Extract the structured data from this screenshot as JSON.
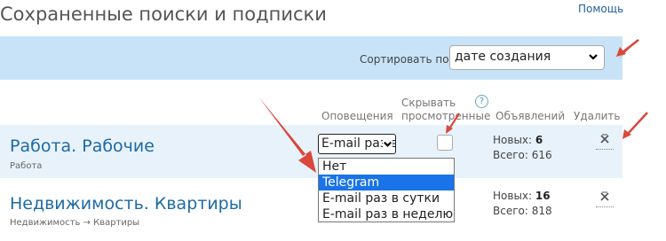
{
  "page": {
    "title": "Сохраненные поиски и подписки",
    "help_link": "Помощь"
  },
  "sort": {
    "label": "Сортировать по",
    "selected": "дате создания"
  },
  "columns": {
    "notifications": "Оповещения",
    "hide_viewed_line1": "Скрывать",
    "hide_viewed_line2": "просмотренные",
    "hide_viewed_help": "?",
    "listings": "Объявлений",
    "delete": "Удалить"
  },
  "rows": [
    {
      "title": "Работа. Рабочие",
      "subtitle": "Работа",
      "notification": "E-mail раз в сутки",
      "new_label": "Новых:",
      "new_count": "6",
      "total_label": "Всего:",
      "total_count": "616"
    },
    {
      "title": "Недвижимость. Квартиры",
      "subtitle": "Недвижимость → Квартиры",
      "notification": "",
      "new_label": "Новых:",
      "new_count": "16",
      "total_label": "Всего:",
      "total_count": "818"
    }
  ],
  "dropdown": {
    "options": [
      "Нет",
      "Telegram",
      "E-mail раз в сутки",
      "E-mail раз в неделю"
    ],
    "highlighted": "Telegram"
  },
  "colors": {
    "accent_blue": "#1d6aa4",
    "sort_bar": "#c8e3f7",
    "row_highlight": "#e8f2fa",
    "option_highlight": "#1a73e8",
    "annotation_arrow": "#d9483b"
  }
}
